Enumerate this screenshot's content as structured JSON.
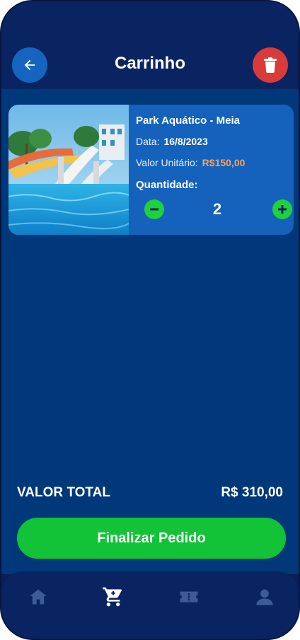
{
  "header": {
    "title": "Carrinho",
    "back_icon": "arrow-left-icon",
    "trash_icon": "trash-icon"
  },
  "cart": {
    "items": [
      {
        "name": "Park Aquático - Meia",
        "date_label": "Data:",
        "date_value": "16/8/2023",
        "unit_price_label": "Valor Unitário:",
        "unit_price_value": "R$150,00",
        "quantity_label": "Quantidade:",
        "quantity": "2",
        "image": "water-park-photo"
      }
    ]
  },
  "summary": {
    "total_label": "VALOR TOTAL",
    "total_value": "R$ 310,00"
  },
  "checkout": {
    "label": "Finalizar Pedido"
  },
  "bottom_nav": {
    "items": [
      {
        "icon": "home-icon",
        "active": false
      },
      {
        "icon": "cart-icon",
        "active": true
      },
      {
        "icon": "ticket-icon",
        "active": false
      },
      {
        "icon": "user-icon",
        "active": false
      }
    ]
  },
  "colors": {
    "background": "#0a1f55",
    "content": "#01387a",
    "card": "#1562bd",
    "accent_green": "#12c337",
    "price_orange": "#f7a25a",
    "danger": "#d93a3a"
  }
}
